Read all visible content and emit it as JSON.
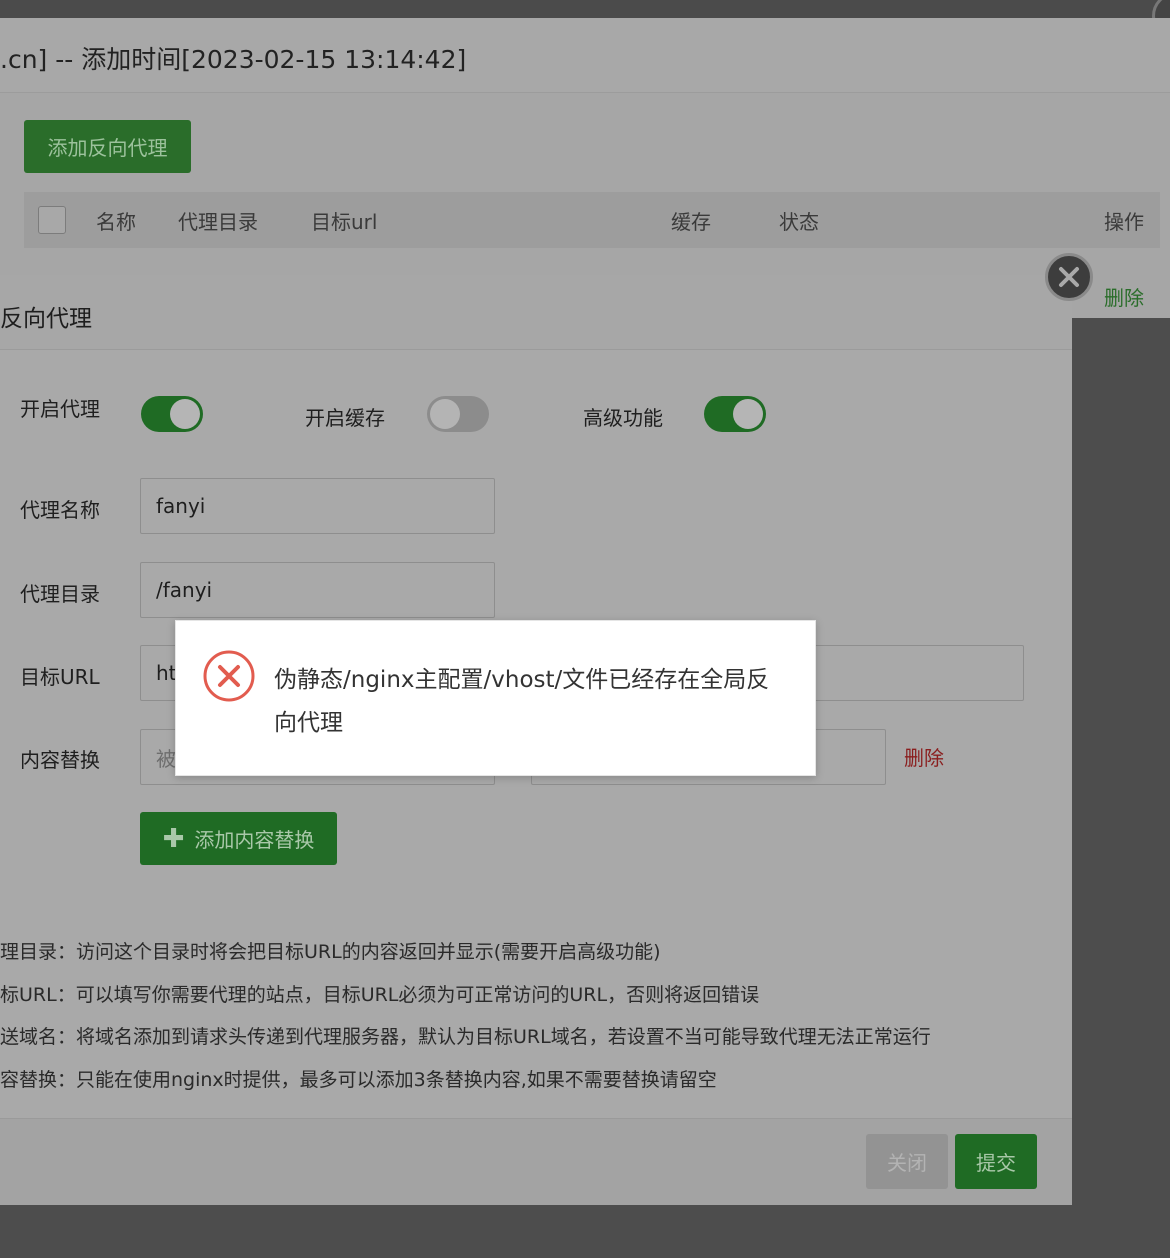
{
  "background_window": {
    "title": ".cn] -- 添加时间[2023-02-15 13:14:42]",
    "add_proxy_button": "添加反向代理",
    "table_headers": [
      "名称",
      "代理目录",
      "目标url",
      "缓存",
      "状态",
      "操作"
    ],
    "row_delete": "删除"
  },
  "dialog": {
    "title": "反向代理",
    "toggles": [
      {
        "label": "开启代理",
        "on": true
      },
      {
        "label": "开启缓存",
        "on": false
      },
      {
        "label": "高级功能",
        "on": true
      }
    ],
    "fields": {
      "proxy_name": {
        "label": "代理名称",
        "value": "fanyi"
      },
      "proxy_dir": {
        "label": "代理目录",
        "value": "/fanyi"
      },
      "target_url": {
        "label": "目标URL",
        "value": "ht"
      },
      "content_replace": {
        "label": "内容替换",
        "placeholder": "被"
      }
    },
    "delete_label": "删除",
    "add_replace_button": "添加内容替换",
    "help_lines": [
      "理目录：访问这个目录时将会把目标URL的内容返回并显示(需要开启高级功能)",
      "标URL：可以填写你需要代理的站点，目标URL必须为可正常访问的URL，否则将返回错误",
      "送域名：将域名添加到请求头传递到代理服务器，默认为目标URL域名，若设置不当可能导致代理无法正常运行",
      "容替换：只能在使用nginx时提供，最多可以添加3条替换内容,如果不需要替换请留空"
    ],
    "close_button": "关闭",
    "submit_button": "提交"
  },
  "toast": {
    "message": "伪静态/nginx主配置/vhost/文件已经存在全局反向代理",
    "icon": "error-x-circle-icon",
    "icon_color": "#e25c4f"
  }
}
